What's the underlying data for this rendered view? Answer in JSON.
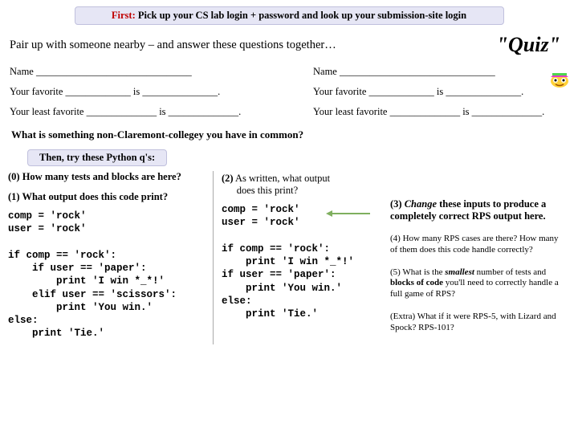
{
  "banner": {
    "first": "First:",
    "rest": "  Pick up your CS lab login + password and look up your submission-site login"
  },
  "header": {
    "pair": "Pair up with someone nearby – and answer these questions together…",
    "quiz": "\"Quiz\""
  },
  "form": {
    "name_label": "Name    _______________________________",
    "fav": "Your favorite _____________ is _______________.",
    "least": "Your least favorite ______________ is ______________."
  },
  "common_q": "What is something non-Claremont-collegey you have in common?",
  "then_pill": "Then, try these Python q's:",
  "left": {
    "q0": "(0) How many tests and blocks are here?",
    "q1": "(1) What output does this code print?",
    "code": "comp = 'rock'\nuser = 'rock'\n\nif comp == 'rock':\n    if user == 'paper':\n        print 'I win *_*!'\n    elif user == 'scissors':\n        print 'You win.'\nelse:\n    print 'Tie.'"
  },
  "mid": {
    "q2a": "(2)",
    "q2b": " As written, what output",
    "q2c": "      does this print?",
    "code": "comp = 'rock'\nuser = 'rock'\n\nif comp == 'rock':\n    print 'I win *_*!'\nif user == 'paper':\n    print 'You win.'\nelse:\n    print 'Tie.'"
  },
  "right": {
    "q3a": "(3) ",
    "q3b": "Change",
    "q3c": " these inputs to produce a completely correct RPS output here.",
    "q4": "(4) How many RPS cases are there? How many of them does this code handle correctly?",
    "q5a": "(5) What is the ",
    "q5b": "smallest",
    "q5c": " number of tests and ",
    "q5d": "blocks of code",
    "q5e": " you'll need to correctly handle a full game of RPS?",
    "extra": "(Extra) What if it were RPS-5, with Lizard and Spock? RPS-101?"
  }
}
